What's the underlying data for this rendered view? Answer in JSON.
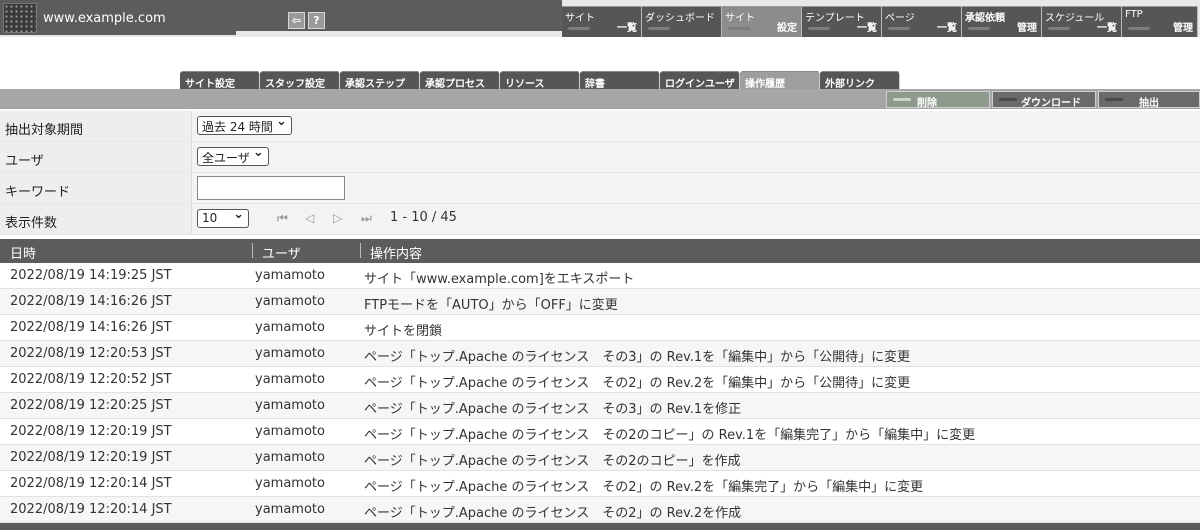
{
  "app": {
    "site_name": "www.example.com",
    "help_label": "?"
  },
  "global_nav": [
    {
      "top": "サイト",
      "bottom": "一覧",
      "active": false
    },
    {
      "top": "ダッシュボード",
      "bottom": "",
      "active": false
    },
    {
      "top": "サイト",
      "bottom": "設定",
      "active": true
    },
    {
      "top": "テンプレート",
      "bottom": "一覧",
      "active": false
    },
    {
      "top": "ページ",
      "bottom": "一覧",
      "active": false
    },
    {
      "top": "承認依頼",
      "bottom": "管理",
      "active": false
    },
    {
      "top": "スケジュール",
      "bottom": "一覧",
      "active": false
    },
    {
      "top": "FTP",
      "bottom": "管理",
      "active": false
    }
  ],
  "sub_tabs": [
    {
      "label": "サイト設定",
      "active": false
    },
    {
      "label": "スタッフ設定",
      "active": false
    },
    {
      "label": "承認ステップ",
      "active": false
    },
    {
      "label": "承認プロセス",
      "active": false
    },
    {
      "label": "リソース",
      "active": false
    },
    {
      "label": "辞書",
      "active": false
    },
    {
      "label": "ログインユーザ",
      "active": false
    },
    {
      "label": "操作履歴",
      "active": true
    },
    {
      "label": "外部リンク",
      "active": false
    }
  ],
  "actions": {
    "delete": "削除",
    "download": "ダウンロード",
    "extract": "抽出"
  },
  "filters": {
    "period_label": "抽出対象期間",
    "period_value": "過去 24 時間",
    "user_label": "ユーザ",
    "user_value": "全ユーザ",
    "keyword_label": "キーワード",
    "keyword_value": "",
    "count_label": "表示件数",
    "count_value": "10",
    "range_text": "1 - 10  /  45"
  },
  "table": {
    "headers": {
      "date": "日時",
      "user": "ユーザ",
      "operation": "操作内容"
    },
    "rows": [
      {
        "date": "2022/08/19 14:19:25 JST",
        "user": "yamamoto",
        "operation": "サイト「www.example.com]をエキスポート"
      },
      {
        "date": "2022/08/19 14:16:26 JST",
        "user": "yamamoto",
        "operation": "FTPモードを「AUTO」から「OFF」に変更"
      },
      {
        "date": "2022/08/19 14:16:26 JST",
        "user": "yamamoto",
        "operation": "サイトを閉鎖"
      },
      {
        "date": "2022/08/19 12:20:53 JST",
        "user": "yamamoto",
        "operation": "ページ「トップ.Apache のライセンス　その3」の Rev.1を「編集中」から「公開待」に変更"
      },
      {
        "date": "2022/08/19 12:20:52 JST",
        "user": "yamamoto",
        "operation": "ページ「トップ.Apache のライセンス　その2」の Rev.2を「編集中」から「公開待」に変更"
      },
      {
        "date": "2022/08/19 12:20:25 JST",
        "user": "yamamoto",
        "operation": "ページ「トップ.Apache のライセンス　その3」の Rev.1を修正"
      },
      {
        "date": "2022/08/19 12:20:19 JST",
        "user": "yamamoto",
        "operation": "ページ「トップ.Apache のライセンス　その2のコピー」の Rev.1を「編集完了」から「編集中」に変更"
      },
      {
        "date": "2022/08/19 12:20:19 JST",
        "user": "yamamoto",
        "operation": "ページ「トップ.Apache のライセンス　その2のコピー」を作成"
      },
      {
        "date": "2022/08/19 12:20:14 JST",
        "user": "yamamoto",
        "operation": "ページ「トップ.Apache のライセンス　その2」の Rev.2を「編集完了」から「編集中」に変更"
      },
      {
        "date": "2022/08/19 12:20:14 JST",
        "user": "yamamoto",
        "operation": "ページ「トップ.Apache のライセンス　その2」の Rev.2を作成"
      }
    ]
  }
}
